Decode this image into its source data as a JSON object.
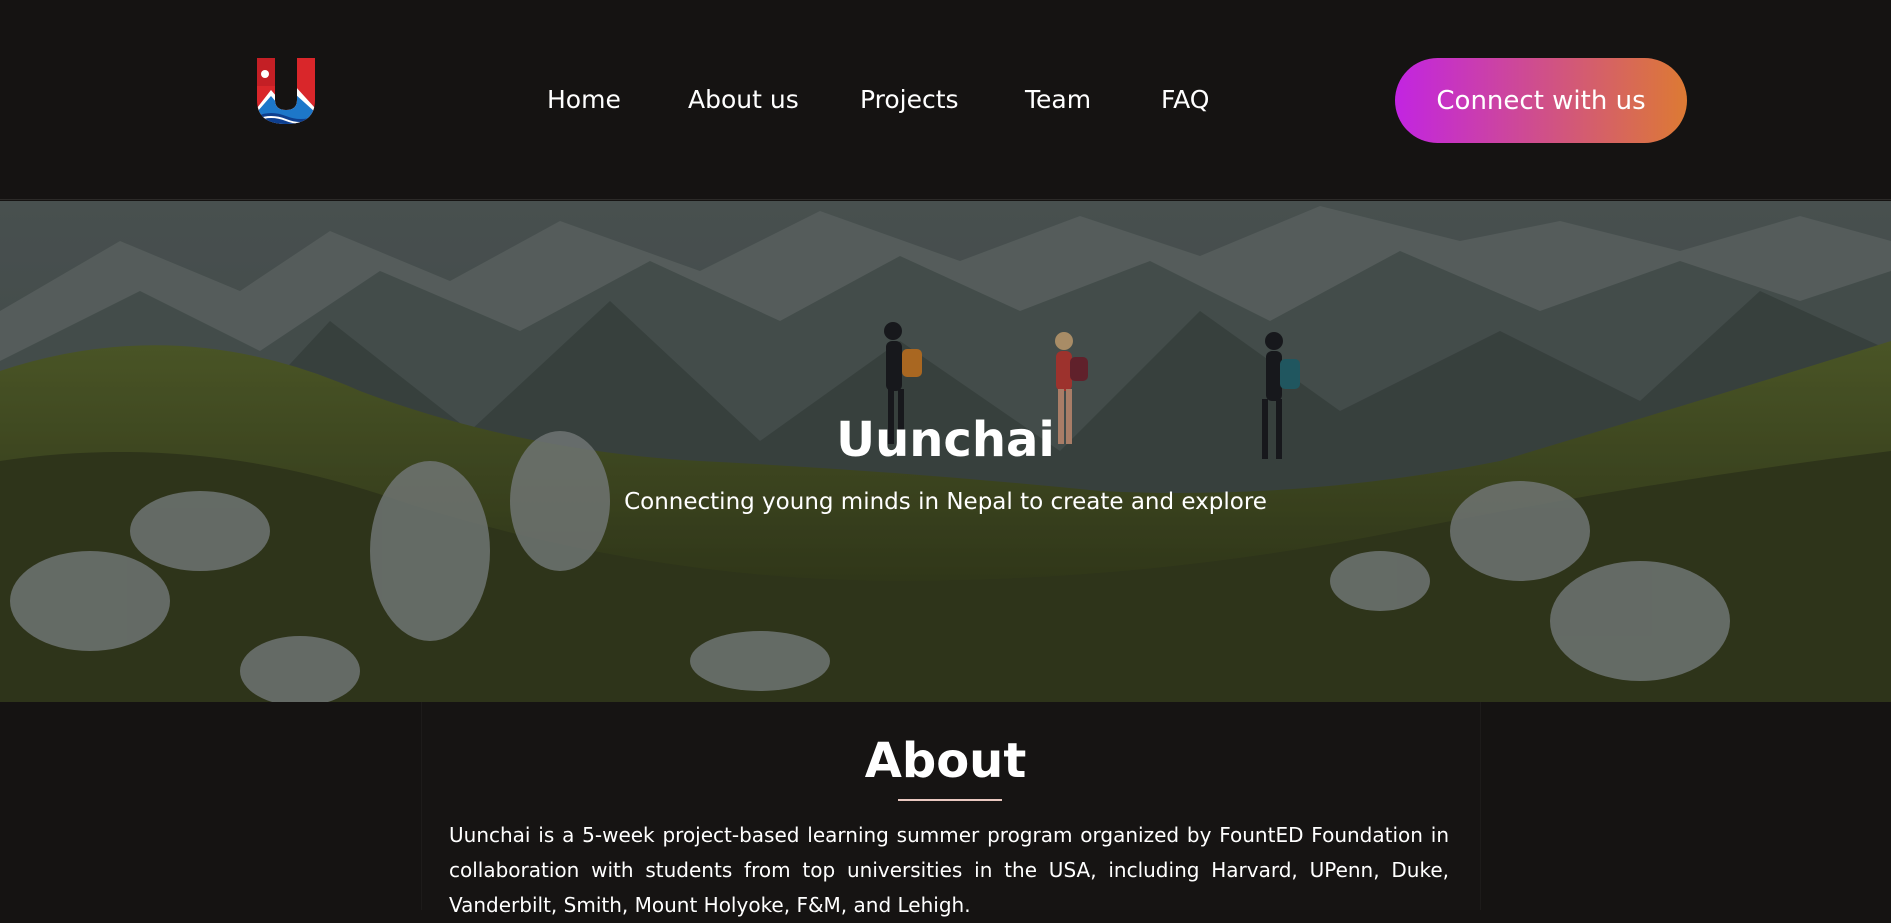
{
  "header": {
    "logo_icon": "uunchai-logo-icon",
    "nav": [
      {
        "label": "Home"
      },
      {
        "label": "About us"
      },
      {
        "label": "Projects"
      },
      {
        "label": "Team"
      },
      {
        "label": "FAQ"
      }
    ],
    "cta_label": "Connect with us",
    "cta_gradient": [
      "#c224e2",
      "#dd7a33"
    ]
  },
  "hero": {
    "title": "Uunchai",
    "subtitle": "Connecting young minds in Nepal to create and explore",
    "image": "mountain-hikers-image"
  },
  "about": {
    "title": "About",
    "underline_color": "#e9c8c0",
    "text": "Uunchai is a 5-week project-based learning summer program organized by FountED Foundation in collaboration with students from top universities in the USA, including Harvard, UPenn, Duke, Vanderbilt, Smith, Mount Holyoke, F&M, and Lehigh."
  },
  "colors": {
    "background": "#151312",
    "text": "#ffffff"
  }
}
